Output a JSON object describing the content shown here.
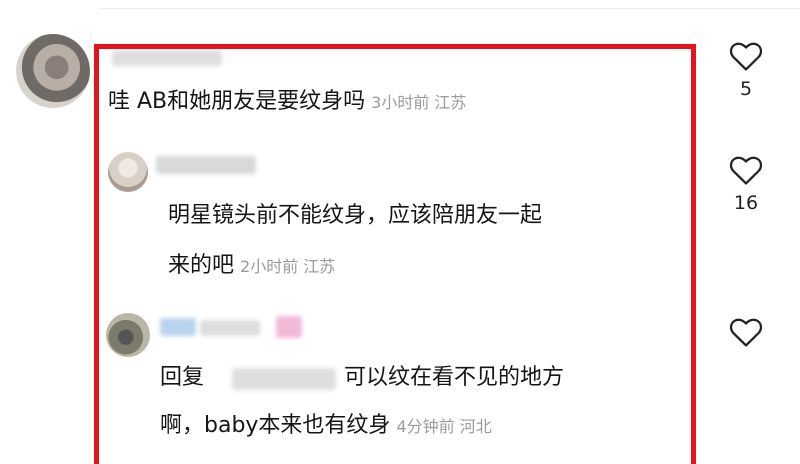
{
  "comments": [
    {
      "username": "…………吃吸",
      "text": "哇 AB和她朋友是要纹身吗",
      "time": "3小时前",
      "location": "江苏",
      "likes": "5"
    },
    {
      "username": "…………",
      "text_line1": "明星镜头前不能纹身，应该陪朋友一起",
      "text_line2": "来的吧",
      "time": "2小时前",
      "location": "江苏",
      "likes": "16"
    },
    {
      "username": "Ang…",
      "reply_prefix": "回复",
      "text_line1_rest": "可以纹在看不见的地方",
      "text_line2": "啊，baby本来也有纹身",
      "time": "4分钟前",
      "location": "河北",
      "likes": ""
    }
  ],
  "colors": {
    "highlight": "#e3141b",
    "meta": "#9b9b9b",
    "text": "#151515"
  },
  "icons": [
    "heart-icon"
  ]
}
